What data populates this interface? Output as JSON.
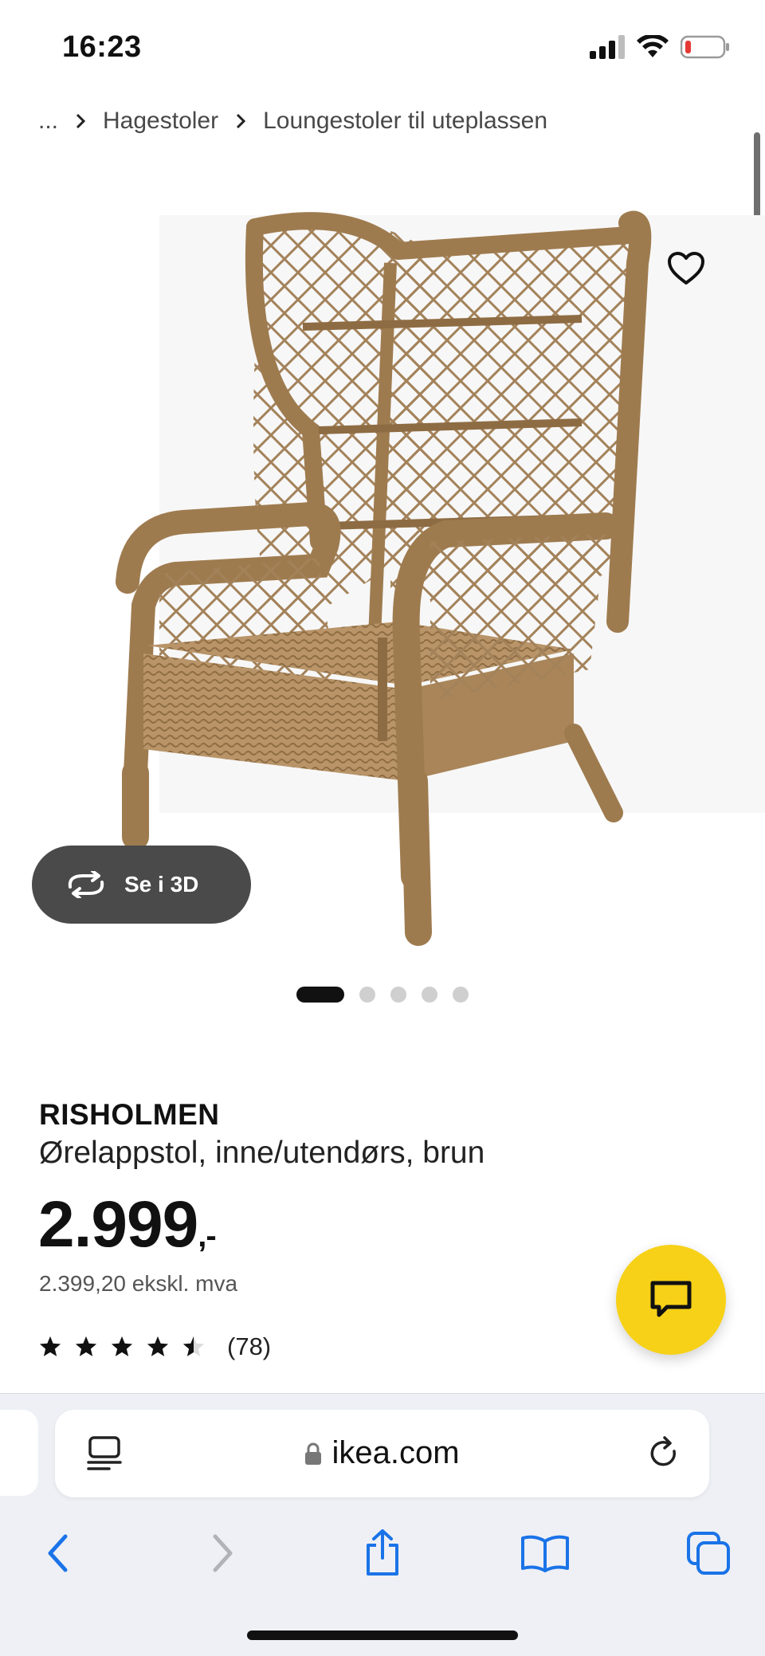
{
  "status_bar": {
    "time": "16:23",
    "icons": [
      "signal-icon",
      "wifi-icon",
      "battery-icon"
    ]
  },
  "breadcrumb": {
    "items": [
      "...",
      "Hagestoler",
      "Loungestoler til uteplassen"
    ]
  },
  "gallery": {
    "view_3d_label": "Se i 3D",
    "image_count": 5,
    "active_index": 0
  },
  "product": {
    "name": "RISHOLMEN",
    "description": "Ørelappstol, inne/utendørs, brun",
    "price_main": "2.999",
    "price_suffix": ",-",
    "price_excl_vat": "2.399,20 ekskl. mva",
    "rating_stars": 4.5,
    "rating_count": "(78)"
  },
  "browser": {
    "url": "ikea.com"
  },
  "colors": {
    "accent_yellow": "#f7d117",
    "safari_blue": "#1a73e8",
    "dark_pill": "#4a4a4a"
  }
}
